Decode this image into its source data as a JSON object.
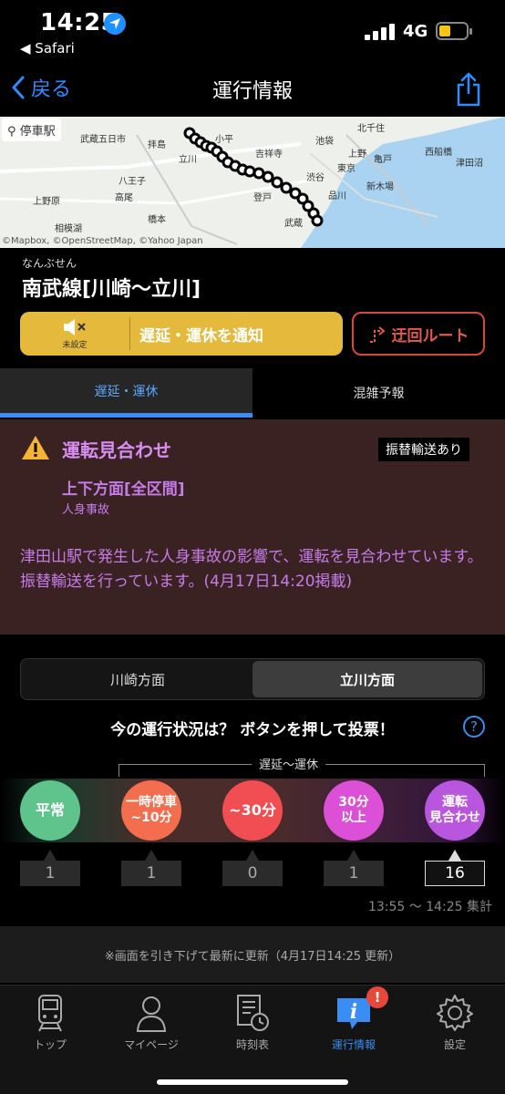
{
  "status_bar": {
    "time": "14:25",
    "back_app": "◀ Safari",
    "network": "4G"
  },
  "nav": {
    "back_label": "戻る",
    "title": "運行情報"
  },
  "map": {
    "chip_label": "停車駅",
    "attribution": "©Mapbox, ©OpenStreetMap, ©Yahoo Japan",
    "places": [
      "武蔵五日市",
      "拝島",
      "立川",
      "八王子",
      "高尾",
      "上野原",
      "相模湖",
      "小平",
      "吉祥寺",
      "池袋",
      "北千住",
      "上野",
      "東京",
      "渋谷",
      "品川",
      "亀戸",
      "西船橋",
      "津田沼",
      "新木場",
      "登戸",
      "武蔵",
      "橋本"
    ]
  },
  "line": {
    "ruby": "なんぶせん",
    "name": "南武線[川崎〜立川]"
  },
  "actions": {
    "mute_sub": "未設定",
    "notify_label": "遅延・運休を通知",
    "detour_label": "迂回ルート"
  },
  "tabs": {
    "delay": "遅延・運休",
    "crowd": "混雑予報"
  },
  "alert": {
    "status": "運転見合わせ",
    "badge": "振替輸送あり",
    "direction": "上下方面[全区間]",
    "cause": "人身事故",
    "description": "津田山駅で発生した人身事故の影響で、運転を見合わせています。振替輸送を行っています。(4月17日14:20掲載)"
  },
  "direction_segment": {
    "left": "川崎方面",
    "right": "立川方面"
  },
  "vote": {
    "title": "今の運行状況は？ ボタンを押して投票！",
    "help": "?",
    "bracket_label": "遅延〜運休",
    "buttons": [
      {
        "line1": "平常",
        "line2": "",
        "count": "1"
      },
      {
        "line1": "一時停車",
        "line2": "~10分",
        "count": "1"
      },
      {
        "line1": "~30分",
        "line2": "",
        "count": "0"
      },
      {
        "line1": "30分",
        "line2": "以上",
        "count": "1"
      },
      {
        "line1": "運転",
        "line2": "見合わせ",
        "count": "16"
      }
    ],
    "tally": "13:55 〜 14:25 集計"
  },
  "refresh_note": "※画面を引き下げて最新に更新（4月17日14:25 更新）",
  "tabbar": {
    "items": [
      "トップ",
      "マイページ",
      "時刻表",
      "運行情報",
      "設定"
    ],
    "badge": "!"
  },
  "colors": {
    "accent": "#3a8df2",
    "notify": "#e5b93b",
    "detour": "#d9473b",
    "alert_bg": "#3a2222",
    "alert_text": "#c57ce8"
  }
}
